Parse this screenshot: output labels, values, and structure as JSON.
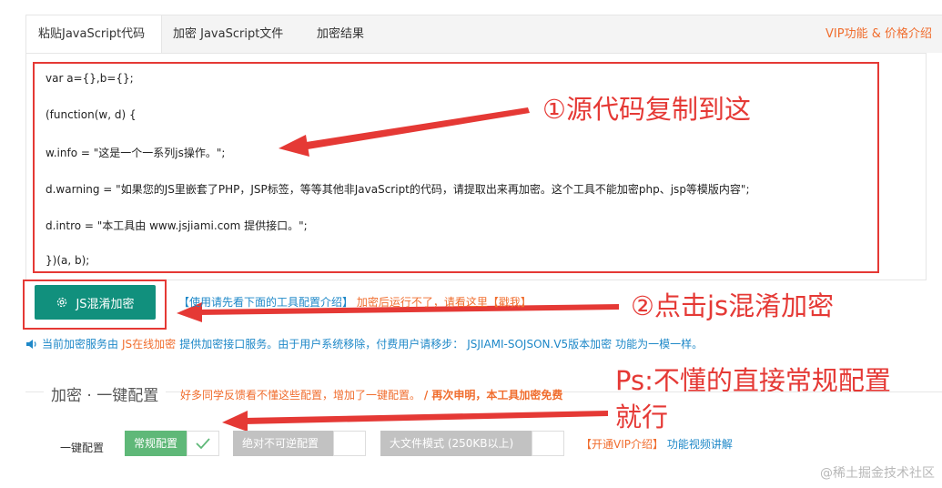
{
  "tabs": [
    {
      "label": "粘贴JavaScript代码"
    },
    {
      "label": "加密 JavaScript文件"
    },
    {
      "label": "加密结果"
    }
  ],
  "vip_link": "VIP功能 & 价格介绍",
  "code_lines": [
    "var a={},b={};",
    "(function(w, d) {",
    " w.info = \"这是一个一系列js操作。\";",
    " d.warning = \"如果您的JS里嵌套了PHP，JSP标签，等等其他非JavaScript的代码，请提取出来再加密。这个工具不能加密php、jsp等模版内容\";",
    " d.intro = \"本工具由 www.jsjiami.com 提供接口。\";",
    "})(a, b);"
  ],
  "annotations": {
    "step1": "①源代码复制到这",
    "step2": "②点击js混淆加密",
    "ps_line1": "Ps:不懂的直接常规配置",
    "ps_line2": "就行"
  },
  "obfuscate_button": "JS混淆加密",
  "tips": {
    "usage": "【使用请先看下面的工具配置介绍】",
    "error": "加密后运行不了，请看这里【戳我】"
  },
  "notice": {
    "prefix": "当前加密服务由",
    "js_online": "JS在线加密",
    "middle": "提供加密接口服务。由于用户系统移除，付费用户请移步：",
    "product": "JSJIAMI-SOJSON.V5版本加密",
    "suffix": "功能为一模一样。"
  },
  "config": {
    "title": "加密 · 一键配置",
    "subtitle": "好多同学反馈看不懂这些配置，增加了一键配置。",
    "subtitle_bold": "/ 再次申明，本工具加密免费",
    "label": "一键配置",
    "options": [
      {
        "label": "常规配置",
        "checked": true
      },
      {
        "label": "绝对不可逆配置",
        "checked": false
      },
      {
        "label": "大文件模式 (250KB以上)",
        "checked": false
      }
    ],
    "vip_intro": "【开通VIP介绍】",
    "video": "功能视频讲解"
  },
  "watermark": "@稀土掘金技术社区",
  "colors": {
    "accent_green": "#11907d",
    "annotation_red": "#e53935",
    "link_blue": "#1e88c8",
    "orange": "#f06d2e",
    "selected_green": "#5fb878"
  }
}
